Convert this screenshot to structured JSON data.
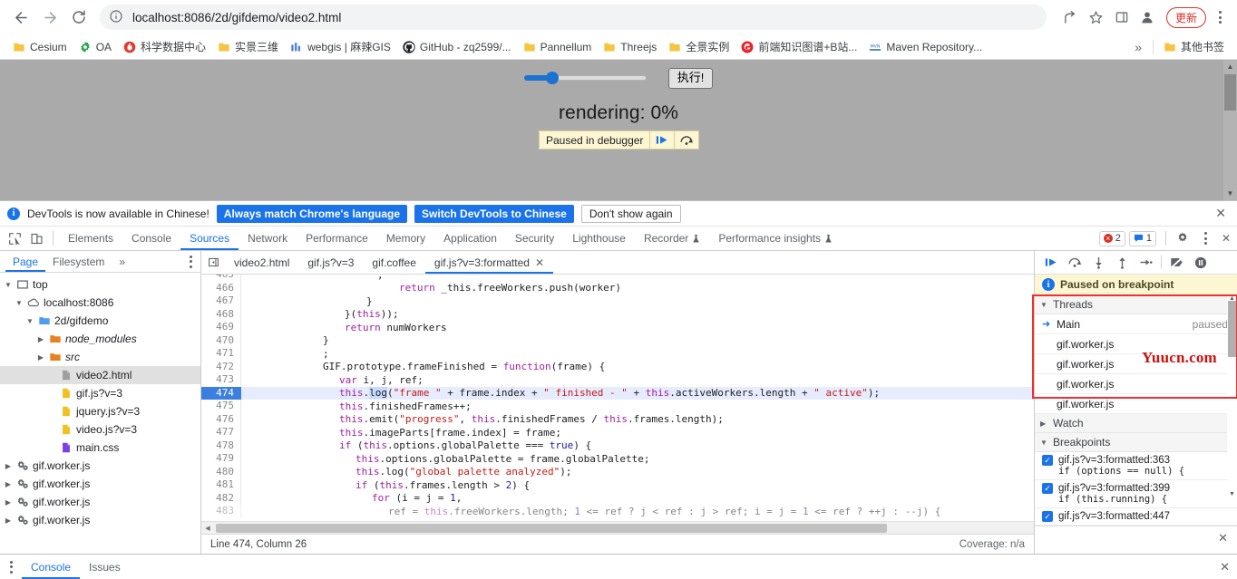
{
  "browser": {
    "url": "localhost:8086/2d/gifdemo/video2.html",
    "back_label": "Back",
    "forward_label": "Forward",
    "reload_label": "Reload",
    "info_icon": "info-circle-icon",
    "share_label": "Share",
    "bookmark_label": "Bookmark this tab",
    "sidepanel_label": "Side panel",
    "profile_label": "Profile",
    "update_label": "更新",
    "menu_label": "Customize and control Google Chrome"
  },
  "bookmarks": [
    {
      "label": "Cesium",
      "icon": "folder-icon",
      "color": "#f5c542"
    },
    {
      "label": "OA",
      "icon": "gear-green-icon",
      "color": "#2aa84a"
    },
    {
      "label": "科学数据中心",
      "icon": "flame-icon",
      "color": "#e23b2e"
    },
    {
      "label": "实景三维",
      "icon": "folder-icon",
      "color": "#f5c542"
    },
    {
      "label": "webgis | 麻辣GIS",
      "icon": "chart-icon",
      "color": "#4a7fd4"
    },
    {
      "label": "GitHub - zq2599/...",
      "icon": "github-icon",
      "color": "#24292e"
    },
    {
      "label": "Pannellum",
      "icon": "folder-icon",
      "color": "#f5c542"
    },
    {
      "label": "Threejs",
      "icon": "folder-icon",
      "color": "#f5c542"
    },
    {
      "label": "全景实例",
      "icon": "folder-icon",
      "color": "#f5c542"
    },
    {
      "label": "前端知识图谱+B站...",
      "icon": "g-circle-icon",
      "color": "#e8242b"
    },
    {
      "label": "Maven Repository...",
      "icon": "mvn-icon",
      "color": "#2f6fb5"
    }
  ],
  "bookmarks_overflow": "»",
  "bookmarks_other": {
    "label": "其他书签",
    "icon": "folder-icon"
  },
  "page": {
    "run_button": "执行!",
    "slider_value": 20,
    "render_text": "rendering: 0%",
    "paused_overlay": {
      "text": "Paused in debugger",
      "resume_icon": "resume-script-icon",
      "step-over_icon": "step-over-icon"
    },
    "scrollbar": {
      "up": "▲",
      "down": "▼"
    }
  },
  "devtools": {
    "banner": {
      "message": "DevTools is now available in Chinese!",
      "primary": "Always match Chrome's language",
      "secondary": "Switch DevTools to Chinese",
      "dismiss": "Don't show again",
      "close_icon": "close-icon"
    },
    "toolbar_icons": [
      "inspect-element-icon",
      "device-toolbar-icon"
    ],
    "tabs": [
      {
        "label": "Elements",
        "active": false
      },
      {
        "label": "Console",
        "active": false
      },
      {
        "label": "Sources",
        "active": true
      },
      {
        "label": "Network",
        "active": false
      },
      {
        "label": "Performance",
        "active": false
      },
      {
        "label": "Memory",
        "active": false
      },
      {
        "label": "Application",
        "active": false
      },
      {
        "label": "Security",
        "active": false
      },
      {
        "label": "Lighthouse",
        "active": false
      },
      {
        "label": "Recorder",
        "active": false,
        "badge_icon": "experiment-icon"
      },
      {
        "label": "Performance insights",
        "active": false,
        "badge_icon": "experiment-icon"
      }
    ],
    "error_count": "2",
    "message_count": "1",
    "settings_icon": "gear-icon",
    "more_icon": "kebab-icon",
    "close_icon": "close-icon"
  },
  "navigator": {
    "tabs": [
      {
        "label": "Page",
        "active": true
      },
      {
        "label": "Filesystem",
        "active": false
      },
      {
        "label": "»",
        "active": false
      }
    ],
    "more_icon": "kebab-icon",
    "tree": [
      {
        "label": "top",
        "indent": 0,
        "arrow": "▼",
        "icon": "frame-icon",
        "italic": false
      },
      {
        "label": "localhost:8086",
        "indent": 1,
        "arrow": "▼",
        "icon": "cloud-icon",
        "italic": false
      },
      {
        "label": "2d/gifdemo",
        "indent": 2,
        "arrow": "▼",
        "icon": "folder-blue-icon",
        "italic": false
      },
      {
        "label": "node_modules",
        "indent": 3,
        "arrow": "▶",
        "icon": "folder-orange-icon",
        "italic": true
      },
      {
        "label": "src",
        "indent": 3,
        "arrow": "▶",
        "icon": "folder-orange-icon",
        "italic": true
      },
      {
        "label": "video2.html",
        "indent": 4,
        "arrow": "",
        "icon": "file-gray-icon",
        "italic": false,
        "selected": true
      },
      {
        "label": "gif.js?v=3",
        "indent": 4,
        "arrow": "",
        "icon": "file-yellow-icon",
        "italic": false
      },
      {
        "label": "jquery.js?v=3",
        "indent": 4,
        "arrow": "",
        "icon": "file-yellow-icon",
        "italic": false
      },
      {
        "label": "video.js?v=3",
        "indent": 4,
        "arrow": "",
        "icon": "file-yellow-icon",
        "italic": false
      },
      {
        "label": "main.css",
        "indent": 4,
        "arrow": "",
        "icon": "file-purple-icon",
        "italic": false
      },
      {
        "label": "gif.worker.js",
        "indent": 0,
        "arrow": "▶",
        "icon": "worker-icon",
        "italic": false
      },
      {
        "label": "gif.worker.js",
        "indent": 0,
        "arrow": "▶",
        "icon": "worker-icon",
        "italic": false
      },
      {
        "label": "gif.worker.js",
        "indent": 0,
        "arrow": "▶",
        "icon": "worker-icon",
        "italic": false
      },
      {
        "label": "gif.worker.js",
        "indent": 0,
        "arrow": "▶",
        "icon": "worker-icon",
        "italic": false
      }
    ]
  },
  "editor": {
    "collapse_icon": "collapse-sidebar-icon",
    "tabs": [
      {
        "label": "video2.html",
        "active": false,
        "closable": false
      },
      {
        "label": "gif.js?v=3",
        "active": false,
        "closable": false
      },
      {
        "label": "gif.coffee",
        "active": false,
        "closable": false
      },
      {
        "label": "gif.js?v=3:formatted",
        "active": true,
        "closable": true
      }
    ],
    "lines": [
      {
        "n": "465",
        "text": ";",
        "indent": 24,
        "partial_top": true
      },
      {
        "n": "466",
        "text": "return _this.freeWorkers.push(worker)",
        "indent": 28
      },
      {
        "n": "467",
        "text": "}",
        "indent": 22
      },
      {
        "n": "468",
        "text": "}(this));",
        "indent": 18
      },
      {
        "n": "469",
        "text": "return numWorkers",
        "indent": 18
      },
      {
        "n": "470",
        "text": "}",
        "indent": 14
      },
      {
        "n": "471",
        "text": ";",
        "indent": 14
      },
      {
        "n": "472",
        "text": "GIF.prototype.frameFinished = function(frame) {",
        "indent": 14
      },
      {
        "n": "473",
        "text": "var i, j, ref;",
        "indent": 17
      },
      {
        "n": "474",
        "text": "this.log(\"frame \" + frame.index + \" finished - \" + this.activeWorkers.length + \" active\");",
        "indent": 17,
        "highlight": true
      },
      {
        "n": "475",
        "text": "this.finishedFrames++;",
        "indent": 17
      },
      {
        "n": "476",
        "text": "this.emit(\"progress\", this.finishedFrames / this.frames.length);",
        "indent": 17
      },
      {
        "n": "477",
        "text": "this.imageParts[frame.index] = frame;",
        "indent": 17
      },
      {
        "n": "478",
        "text": "if (this.options.globalPalette === true) {",
        "indent": 17
      },
      {
        "n": "479",
        "text": "this.options.globalPalette = frame.globalPalette;",
        "indent": 20
      },
      {
        "n": "480",
        "text": "this.log(\"global palette analyzed\");",
        "indent": 20
      },
      {
        "n": "481",
        "text": "if (this.frames.length > 2) {",
        "indent": 20
      },
      {
        "n": "482",
        "text": "for (i = j = 1,",
        "indent": 23
      },
      {
        "n": "483",
        "text": "ref = this.freeWorkers.length; 1 <= ref ? j < ref : j > ref; i = j = 1 <= ref ? ++j : --j) {",
        "indent": 26,
        "partial": true
      }
    ],
    "status": "Line 474, Column 26",
    "coverage": "Coverage: n/a"
  },
  "debugger": {
    "toolbar": [
      "resume-script-icon",
      "step-over-icon",
      "step-into-icon",
      "step-out-icon",
      "step-icon",
      "deactivate-breakpoints-icon",
      "pause-on-exceptions-icon"
    ],
    "paused_banner": "Paused on breakpoint",
    "threads": {
      "title": "Threads",
      "expanded": true,
      "items": [
        {
          "label": "Main",
          "status": "paused",
          "current": true
        },
        {
          "label": "gif.worker.js",
          "status": "",
          "current": false
        },
        {
          "label": "gif.worker.js",
          "status": "",
          "current": false
        },
        {
          "label": "gif.worker.js",
          "status": "",
          "current": false
        },
        {
          "label": "gif.worker.js",
          "status": "",
          "current": false
        }
      ]
    },
    "watch": {
      "title": "Watch",
      "expanded": false
    },
    "breakpoints": {
      "title": "Breakpoints",
      "expanded": true,
      "items": [
        {
          "location": "gif.js?v=3:formatted:363",
          "code": "if (options == null) {",
          "checked": true
        },
        {
          "location": "gif.js?v=3:formatted:399",
          "code": "if (this.running) {",
          "checked": true
        },
        {
          "location": "gif.js?v=3:formatted:447",
          "code": "",
          "checked": true
        }
      ]
    },
    "close_icon": "close-icon"
  },
  "drawer": {
    "more_icon": "kebab-icon",
    "tabs": [
      {
        "label": "Console",
        "active": true
      },
      {
        "label": "Issues",
        "active": false
      }
    ],
    "close_icon": "close-icon"
  },
  "watermark": "Yuucn.com"
}
